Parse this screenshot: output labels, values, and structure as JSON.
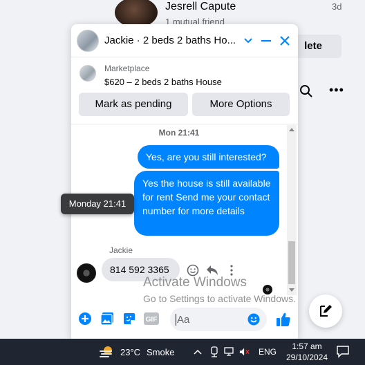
{
  "background": {
    "contact_name": "Jesrell Capute",
    "mutual": "1 mutual friend",
    "time": "3d",
    "delete_label": "lete"
  },
  "chat": {
    "title": "Jackie · 2 beds 2 baths Ho...",
    "marketplace_label": "Marketplace",
    "listing": "$620 – 2 beds 2 baths House",
    "mark_pending": "Mark as pending",
    "more_options": "More Options",
    "date_separator": "Mon 21:41",
    "tooltip": "Monday 21:41",
    "outgoing": [
      "Yes, are you still interested?",
      "Yes the house is still available for rent Send me your contact number for more details"
    ],
    "sender_name": "Jackie",
    "incoming": "814 592 3365",
    "input_placeholder": "Aa",
    "accent": "#0084ff"
  },
  "watermark": {
    "title": "Activate Windows",
    "subtitle": "Go to Settings to activate Windows."
  },
  "taskbar": {
    "temperature": "23°C",
    "condition": "Smoke",
    "language": "ENG",
    "time": "1:57 am",
    "date": "29/10/2024"
  }
}
